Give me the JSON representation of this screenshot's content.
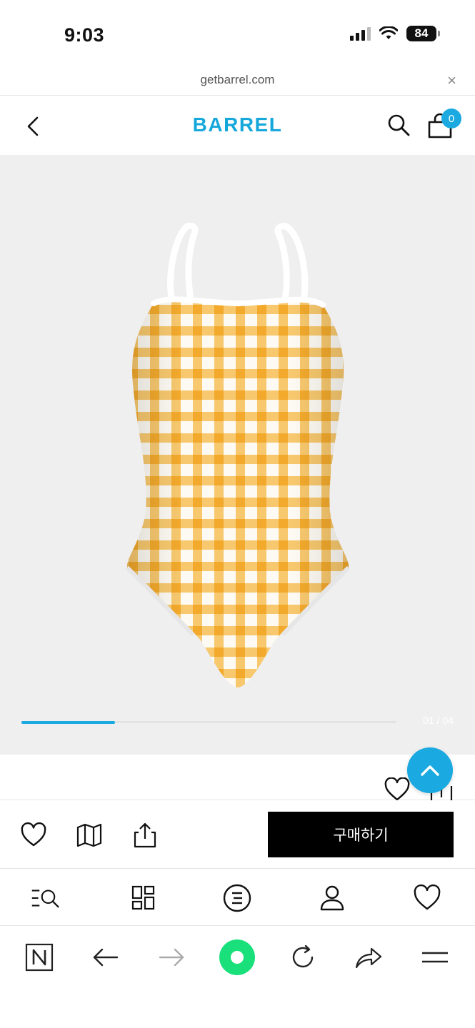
{
  "status": {
    "time": "9:03",
    "battery": "84"
  },
  "browser": {
    "url": "getbarrel.com",
    "close_symbol": "×"
  },
  "header": {
    "logo_text": "BARREL",
    "cart_count": "0"
  },
  "gallery": {
    "counter": "01 / 04",
    "progress": 0.25
  },
  "actions": {
    "buy_label": "구매하기"
  },
  "icons": {
    "back": "chevron-left-icon",
    "search": "search-icon",
    "cart": "shopping-bag-icon",
    "wishlist": "heart-icon",
    "map": "map-icon",
    "share": "share-icon",
    "scroll_top": "chevron-up-icon",
    "category_search": "menu-search-icon",
    "grid": "grid-icon",
    "menu": "menu-circle-icon",
    "user": "user-icon",
    "naver": "naver-n-icon",
    "browser_back": "arrow-left-icon",
    "browser_forward": "arrow-right-icon",
    "reload": "reload-icon",
    "browser_share": "share-arrow-icon",
    "browser_menu": "hamburger-icon"
  },
  "colors": {
    "brand": "#1aa9e0",
    "buy_button": "#000000",
    "gingham": "#f4a51c",
    "naver_green": "#19e07a"
  }
}
